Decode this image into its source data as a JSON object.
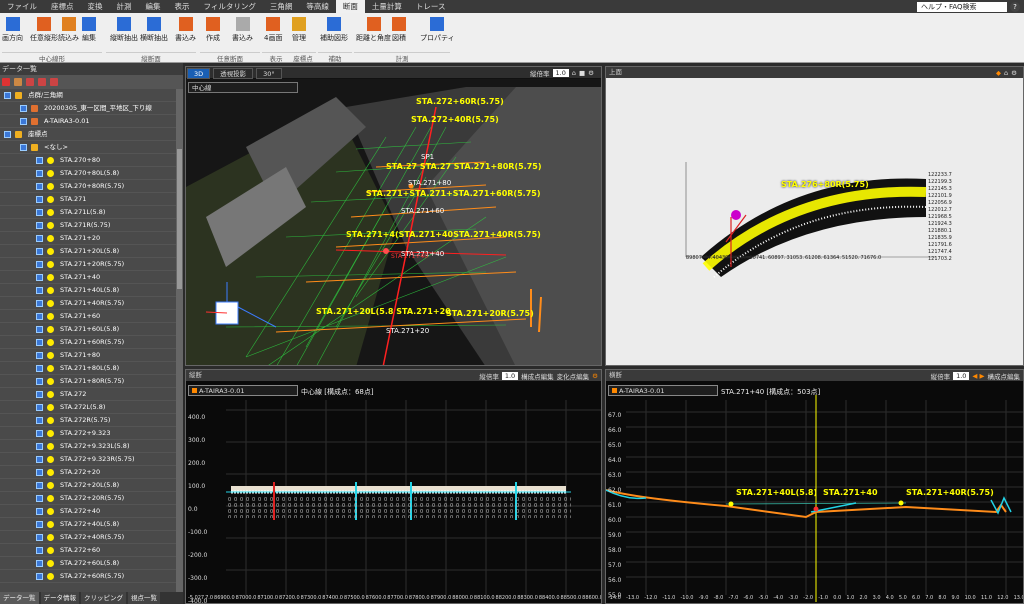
{
  "menu": {
    "items": [
      "ファイル",
      "座標点",
      "変換",
      "計測",
      "編集",
      "表示",
      "フィルタリング",
      "三角網",
      "等高線",
      "断面",
      "土量計算",
      "トレース"
    ],
    "active_index": 9,
    "help_label": "ヘルプ・FAQ検索",
    "help_icon": "?"
  },
  "ribbon": {
    "buttons": [
      "画方向",
      "任意縦形",
      "読込み",
      "編集",
      "縦断抽出",
      "横断抽出",
      "書込み",
      "作成",
      "書込み",
      "4画面",
      "管理",
      "補助図形",
      "距離と角度",
      "図積",
      "プロパティ"
    ],
    "groups": [
      "中心線形",
      "縦断面",
      "任意断面",
      "表示",
      "座標点",
      "補助",
      "計測"
    ]
  },
  "left_panel": {
    "title": "データ一覧",
    "tree": [
      {
        "label": "点群/三角網",
        "level": 0,
        "kind": "folder"
      },
      {
        "label": "20200305_東一区間_平地区_下り線",
        "level": 1,
        "kind": "cloud"
      },
      {
        "label": "A-TAIRA3-0.01",
        "level": 1,
        "kind": "cloud"
      },
      {
        "label": "座標点",
        "level": 0,
        "kind": "folder"
      },
      {
        "label": "<なし>",
        "level": 1,
        "kind": "group"
      },
      {
        "label": "STA.270+80",
        "level": 2,
        "kind": "point"
      },
      {
        "label": "STA.270+80L(5.8)",
        "level": 2,
        "kind": "point"
      },
      {
        "label": "STA.270+80R(5.75)",
        "level": 2,
        "kind": "point"
      },
      {
        "label": "STA.271",
        "level": 2,
        "kind": "point"
      },
      {
        "label": "STA.271L(5.8)",
        "level": 2,
        "kind": "point"
      },
      {
        "label": "STA.271R(5.75)",
        "level": 2,
        "kind": "point"
      },
      {
        "label": "STA.271+20",
        "level": 2,
        "kind": "point"
      },
      {
        "label": "STA.271+20L(5.8)",
        "level": 2,
        "kind": "point"
      },
      {
        "label": "STA.271+20R(5.75)",
        "level": 2,
        "kind": "point"
      },
      {
        "label": "STA.271+40",
        "level": 2,
        "kind": "point"
      },
      {
        "label": "STA.271+40L(5.8)",
        "level": 2,
        "kind": "point"
      },
      {
        "label": "STA.271+40R(5.75)",
        "level": 2,
        "kind": "point"
      },
      {
        "label": "STA.271+60",
        "level": 2,
        "kind": "point"
      },
      {
        "label": "STA.271+60L(5.8)",
        "level": 2,
        "kind": "point"
      },
      {
        "label": "STA.271+60R(5.75)",
        "level": 2,
        "kind": "point"
      },
      {
        "label": "STA.271+80",
        "level": 2,
        "kind": "point"
      },
      {
        "label": "STA.271+80L(5.8)",
        "level": 2,
        "kind": "point"
      },
      {
        "label": "STA.271+80R(5.75)",
        "level": 2,
        "kind": "point"
      },
      {
        "label": "STA.272",
        "level": 2,
        "kind": "point"
      },
      {
        "label": "STA.272L(5.8)",
        "level": 2,
        "kind": "point"
      },
      {
        "label": "STA.272R(5.75)",
        "level": 2,
        "kind": "point"
      },
      {
        "label": "STA.272+9.323",
        "level": 2,
        "kind": "point"
      },
      {
        "label": "STA.272+9.323L(5.8)",
        "level": 2,
        "kind": "point"
      },
      {
        "label": "STA.272+9.323R(5.75)",
        "level": 2,
        "kind": "point"
      },
      {
        "label": "STA.272+20",
        "level": 2,
        "kind": "point"
      },
      {
        "label": "STA.272+20L(5.8)",
        "level": 2,
        "kind": "point"
      },
      {
        "label": "STA.272+20R(5.75)",
        "level": 2,
        "kind": "point"
      },
      {
        "label": "STA.272+40",
        "level": 2,
        "kind": "point"
      },
      {
        "label": "STA.272+40L(5.8)",
        "level": 2,
        "kind": "point"
      },
      {
        "label": "STA.272+40R(5.75)",
        "level": 2,
        "kind": "point"
      },
      {
        "label": "STA.272+60",
        "level": 2,
        "kind": "point"
      },
      {
        "label": "STA.272+60L(5.8)",
        "level": 2,
        "kind": "point"
      },
      {
        "label": "STA.272+60R(5.75)",
        "level": 2,
        "kind": "point"
      }
    ],
    "tabs": [
      "データ一覧",
      "データ情報",
      "クリッピング",
      "視点一覧"
    ]
  },
  "view3d": {
    "tabs": [
      "3D",
      "透視投影",
      "30°"
    ],
    "combo": "中心線",
    "zoom_label": "縦倍率",
    "zoom": "1.0",
    "labels_yellow": [
      "STA.271+4(STA.271+40STA.271+40R(5.75)",
      "STA.271+STA.271+STA.271+60R(5.75)",
      "STA.27 STA.27 STA.271+80R(5.75)",
      "STA.271+20L(5.8 STA.271+20",
      "STA.271+20R(5.75)",
      "STA.272+60R(5.75)",
      "STA.272+40R(5.75)"
    ],
    "labels_white": [
      "STA.271+40",
      "STA.271+20",
      "STA.271+60",
      "STA.271+80",
      "SP1"
    ],
    "label_red": "STA.271+40"
  },
  "top_view": {
    "title": "上面",
    "label": "STA.276+80R(5.75)",
    "y_ticks": [
      "122233.7",
      "122199.3",
      "122145.3",
      "122101.9",
      "122056.9",
      "122012.7",
      "121968.5",
      "121924.3",
      "121880.1",
      "121835.9",
      "121791.6",
      "121747.4",
      "121703.2"
    ],
    "x_ticks": [
      "89807.",
      "74.40430.",
      "50585.",
      "80741.",
      "60897.",
      "31053.",
      "61208.",
      "61364.",
      "51520.",
      "71676.0"
    ]
  },
  "long_section": {
    "title": "縦断",
    "zoom_label": "縦倍率",
    "zoom": "1.0",
    "edit1": "構成点編集",
    "edit2": "変化点編集",
    "select": "A-TAIRA3-0.01",
    "caption": "中心線 [構成点：68点]",
    "y_ticks": [
      "400.0",
      "300.0",
      "200.0",
      "100.0",
      "0.0",
      "-100.0",
      "-200.0",
      "-300.0",
      "-400.0"
    ],
    "x_ticks": [
      "-5.027",
      "7.0",
      "86900.0",
      "87000.0",
      "87100.0",
      "87200.0",
      "87300.0",
      "87400.0",
      "87500.0",
      "87600.0",
      "87700.0",
      "87800.0",
      "87900.0",
      "88000.0",
      "88100.0",
      "88200.0",
      "88300.0",
      "88400.0",
      "88500.0",
      "88600.0"
    ]
  },
  "cross_section": {
    "title": "横断",
    "zoom_label": "縦倍率",
    "zoom": "1.0",
    "edit1": "構成点編集",
    "select": "A-TAIRA3-0.01",
    "caption": "STA.271+40 [構成点：503点]",
    "labels": [
      "STA.271+40L(5.8)",
      "STA.271+40",
      "STA.271+40R(5.75)"
    ],
    "y_ticks": [
      "67.0",
      "66.0",
      "65.0",
      "64.0",
      "63.0",
      "62.0",
      "61.0",
      "60.0",
      "59.0",
      "58.0",
      "57.0",
      "56.0",
      "55.0"
    ],
    "x_ticks": [
      "-14.0",
      "-13.0",
      "-12.0",
      "-11.0",
      "-10.0",
      "-9.0",
      "-8.0",
      "-7.0",
      "-6.0",
      "-5.0",
      "-4.0",
      "-3.0",
      "-2.0",
      "-1.0",
      "0.0",
      "1.0",
      "2.0",
      "3.0",
      "4.0",
      "5.0",
      "6.0",
      "7.0",
      "8.0",
      "9.0",
      "10.0",
      "11.0",
      "12.0",
      "13.0"
    ]
  },
  "colors": {
    "accent": "#1a5fb4",
    "label": "#ffff00",
    "centerline": "#ff2020",
    "profile": "#ff8c1a",
    "cyan": "#22d3e6"
  }
}
